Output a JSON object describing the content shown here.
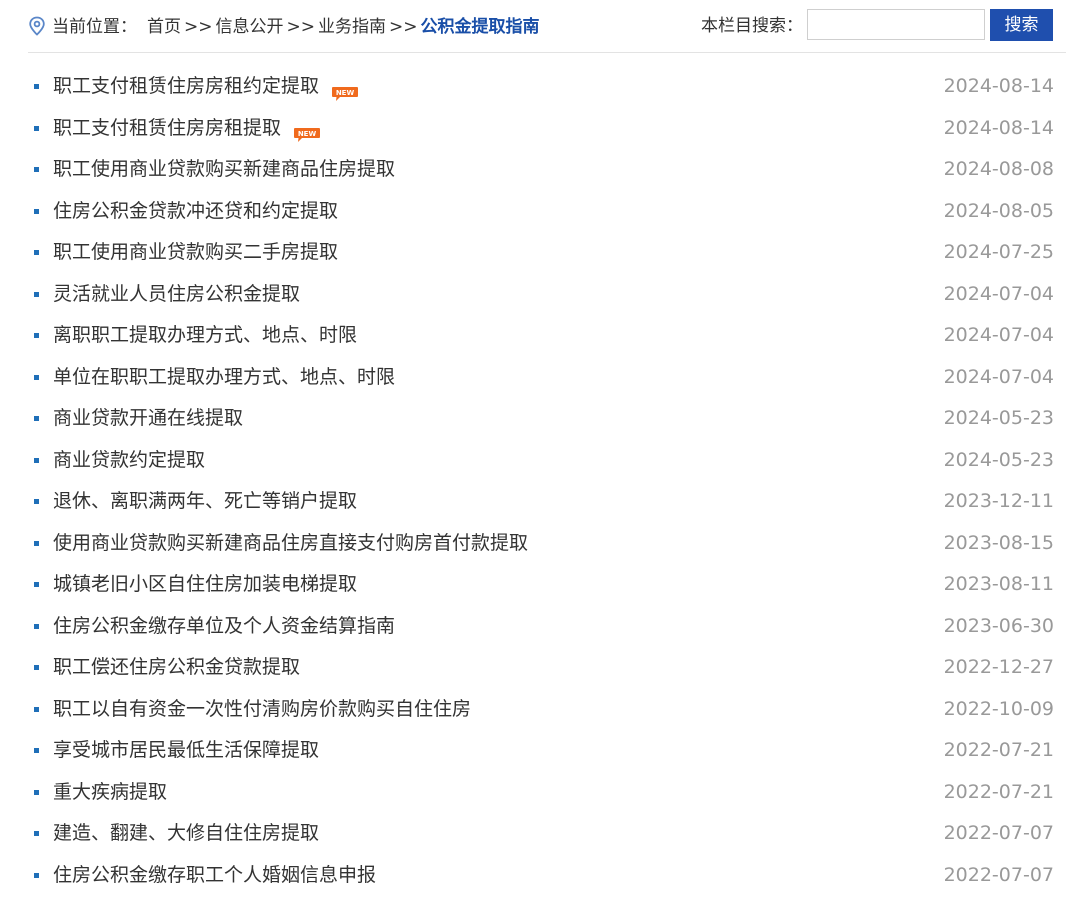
{
  "breadcrumb": {
    "lead": "当前位置：",
    "items": [
      "首页",
      "信息公开",
      "业务指南"
    ],
    "separator": ">>",
    "current": "公积金提取指南"
  },
  "search": {
    "label": "本栏目搜索：",
    "value": "",
    "placeholder": "",
    "button_label": "搜索"
  },
  "badge": {
    "text": "NEW",
    "color": "#f06a1d"
  },
  "colors": {
    "accent": "#1f4fae",
    "bullet": "#1f6fb8",
    "date": "#999999"
  },
  "items": [
    {
      "title": "职工支付租赁住房房租约定提取",
      "date": "2024-08-14",
      "is_new": true
    },
    {
      "title": "职工支付租赁住房房租提取",
      "date": "2024-08-14",
      "is_new": true
    },
    {
      "title": "职工使用商业贷款购买新建商品住房提取",
      "date": "2024-08-08",
      "is_new": false
    },
    {
      "title": "住房公积金贷款冲还贷和约定提取",
      "date": "2024-08-05",
      "is_new": false
    },
    {
      "title": "职工使用商业贷款购买二手房提取",
      "date": "2024-07-25",
      "is_new": false
    },
    {
      "title": "灵活就业人员住房公积金提取",
      "date": "2024-07-04",
      "is_new": false
    },
    {
      "title": "离职职工提取办理方式、地点、时限",
      "date": "2024-07-04",
      "is_new": false
    },
    {
      "title": "单位在职职工提取办理方式、地点、时限",
      "date": "2024-07-04",
      "is_new": false
    },
    {
      "title": "商业贷款开通在线提取",
      "date": "2024-05-23",
      "is_new": false
    },
    {
      "title": "商业贷款约定提取",
      "date": "2024-05-23",
      "is_new": false
    },
    {
      "title": "退休、离职满两年、死亡等销户提取",
      "date": "2023-12-11",
      "is_new": false
    },
    {
      "title": "使用商业贷款购买新建商品住房直接支付购房首付款提取",
      "date": "2023-08-15",
      "is_new": false
    },
    {
      "title": "城镇老旧小区自住住房加装电梯提取",
      "date": "2023-08-11",
      "is_new": false
    },
    {
      "title": "住房公积金缴存单位及个人资金结算指南",
      "date": "2023-06-30",
      "is_new": false
    },
    {
      "title": "职工偿还住房公积金贷款提取",
      "date": "2022-12-27",
      "is_new": false
    },
    {
      "title": "职工以自有资金一次性付清购房价款购买自住住房",
      "date": "2022-10-09",
      "is_new": false
    },
    {
      "title": "享受城市居民最低生活保障提取",
      "date": "2022-07-21",
      "is_new": false
    },
    {
      "title": "重大疾病提取",
      "date": "2022-07-21",
      "is_new": false
    },
    {
      "title": "建造、翻建、大修自住住房提取",
      "date": "2022-07-07",
      "is_new": false
    },
    {
      "title": "住房公积金缴存职工个人婚姻信息申报",
      "date": "2022-07-07",
      "is_new": false
    }
  ]
}
